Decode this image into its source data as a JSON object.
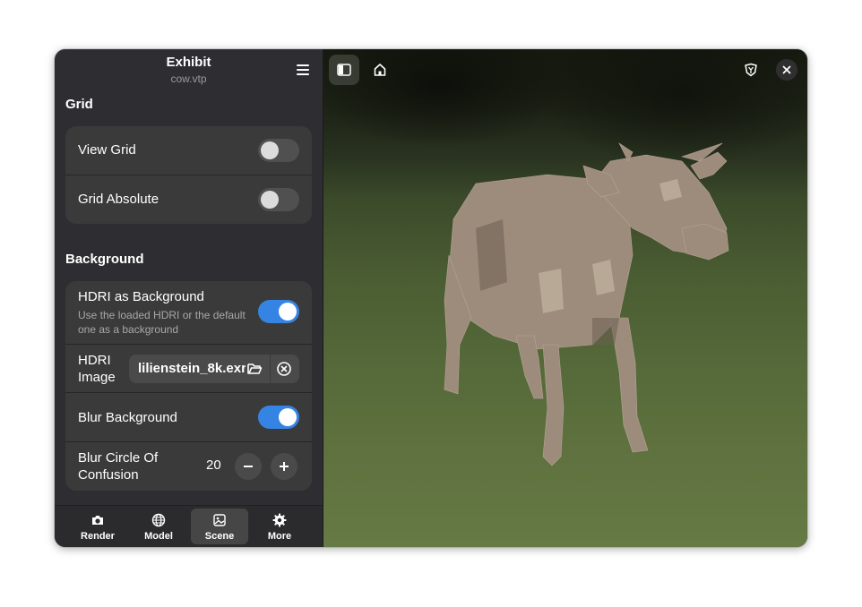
{
  "header": {
    "title": "Exhibit",
    "subtitle": "cow.vtp",
    "menu_icon": "hamburger-menu-icon"
  },
  "grid": {
    "section_title": "Grid",
    "view_grid": {
      "label": "View Grid",
      "enabled": false
    },
    "grid_absolute": {
      "label": "Grid Absolute",
      "enabled": false
    }
  },
  "background": {
    "section_title": "Background",
    "hdri_as_background": {
      "label": "HDRI as Background",
      "description": "Use the loaded HDRI or the default one as a background",
      "enabled": true
    },
    "hdri_image": {
      "label": "HDRI Image",
      "file": "lilienstein_8k.exr"
    },
    "blur_background": {
      "label": "Blur Background",
      "enabled": true
    },
    "blur_coc": {
      "label": "Blur Circle Of Confusion",
      "value": "20"
    }
  },
  "tabs": [
    {
      "label": "Render",
      "icon": "camera-icon",
      "active": false
    },
    {
      "label": "Model",
      "icon": "globe-icon",
      "active": false
    },
    {
      "label": "Scene",
      "icon": "image-icon",
      "active": true
    },
    {
      "label": "More",
      "icon": "gear-icon",
      "active": false
    }
  ],
  "viewer": {
    "buttons": [
      "sidebar-toggle-icon",
      "home-icon",
      "shield-icon",
      "close-icon"
    ]
  },
  "colors": {
    "accent": "#3584e4",
    "sidebar_bg": "#2e2e32",
    "card_bg": "#3a3a3a"
  }
}
